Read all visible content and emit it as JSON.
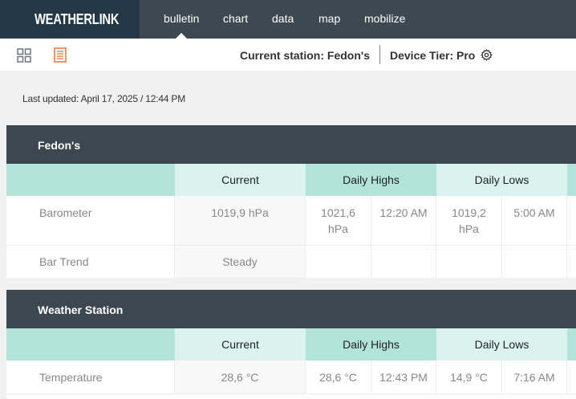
{
  "app": {
    "logo": "WEATHERLINK"
  },
  "nav": [
    {
      "label": "bulletin",
      "active": true
    },
    {
      "label": "chart"
    },
    {
      "label": "data"
    },
    {
      "label": "map"
    },
    {
      "label": "mobilize"
    }
  ],
  "toolbar": {
    "current_station": "Current station: Fedon's",
    "device_tier": "Device Tier: Pro",
    "active_view": "bulletin"
  },
  "last_updated": "Last updated: April 17, 2025 / 12:44 PM",
  "columns": {
    "current": "Current",
    "highs": "Daily Highs",
    "lows": "Daily Lows"
  },
  "sections": [
    {
      "title": "Fedon's",
      "rows": [
        {
          "label": "Barometer",
          "current": "1019,9 hPa",
          "high_value": "1021,6 hPa",
          "high_time": "12:20 AM",
          "low_value": "1019,2 hPa",
          "low_time": "5:00 AM"
        },
        {
          "label": "Bar Trend",
          "current": "Steady",
          "high_value": "",
          "high_time": "",
          "low_value": "",
          "low_time": ""
        }
      ]
    },
    {
      "title": "Weather Station",
      "rows": [
        {
          "label": "Temperature",
          "current": "28,6 °C",
          "high_value": "28,6 °C",
          "high_time": "12:43 PM",
          "low_value": "14,9 °C",
          "low_time": "7:16 AM"
        }
      ]
    }
  ],
  "colors": {
    "nav_bg": "#3d4850",
    "logo_bg": "#223847",
    "accent_orange": "#e8743b",
    "header_mint": "#b3e4d9",
    "header_mint_light": "#daf3ee"
  }
}
